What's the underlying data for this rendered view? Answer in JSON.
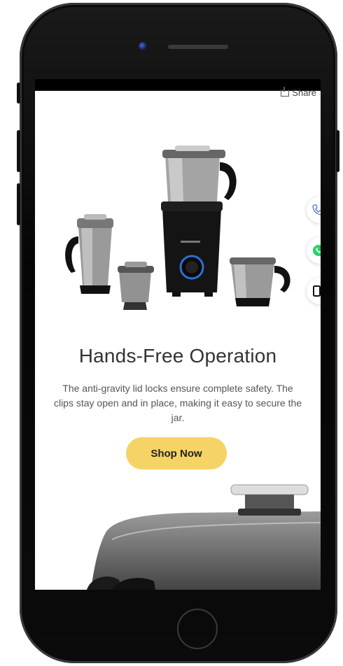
{
  "header": {
    "share_label": "Share"
  },
  "feature": {
    "title": "Hands-Free Operation",
    "description": "The anti-gravity lid locks ensure complete safety. The clips stay open and in place, making it easy to secure the jar.",
    "cta_label": "Shop Now"
  },
  "floating_actions": [
    {
      "icon": "phone-icon"
    },
    {
      "icon": "whatsapp-icon"
    },
    {
      "icon": "mobile-icon"
    }
  ],
  "colors": {
    "cta_background": "#f6d365",
    "whatsapp_green": "#25d366",
    "phone_blue": "#4a7bd8"
  }
}
